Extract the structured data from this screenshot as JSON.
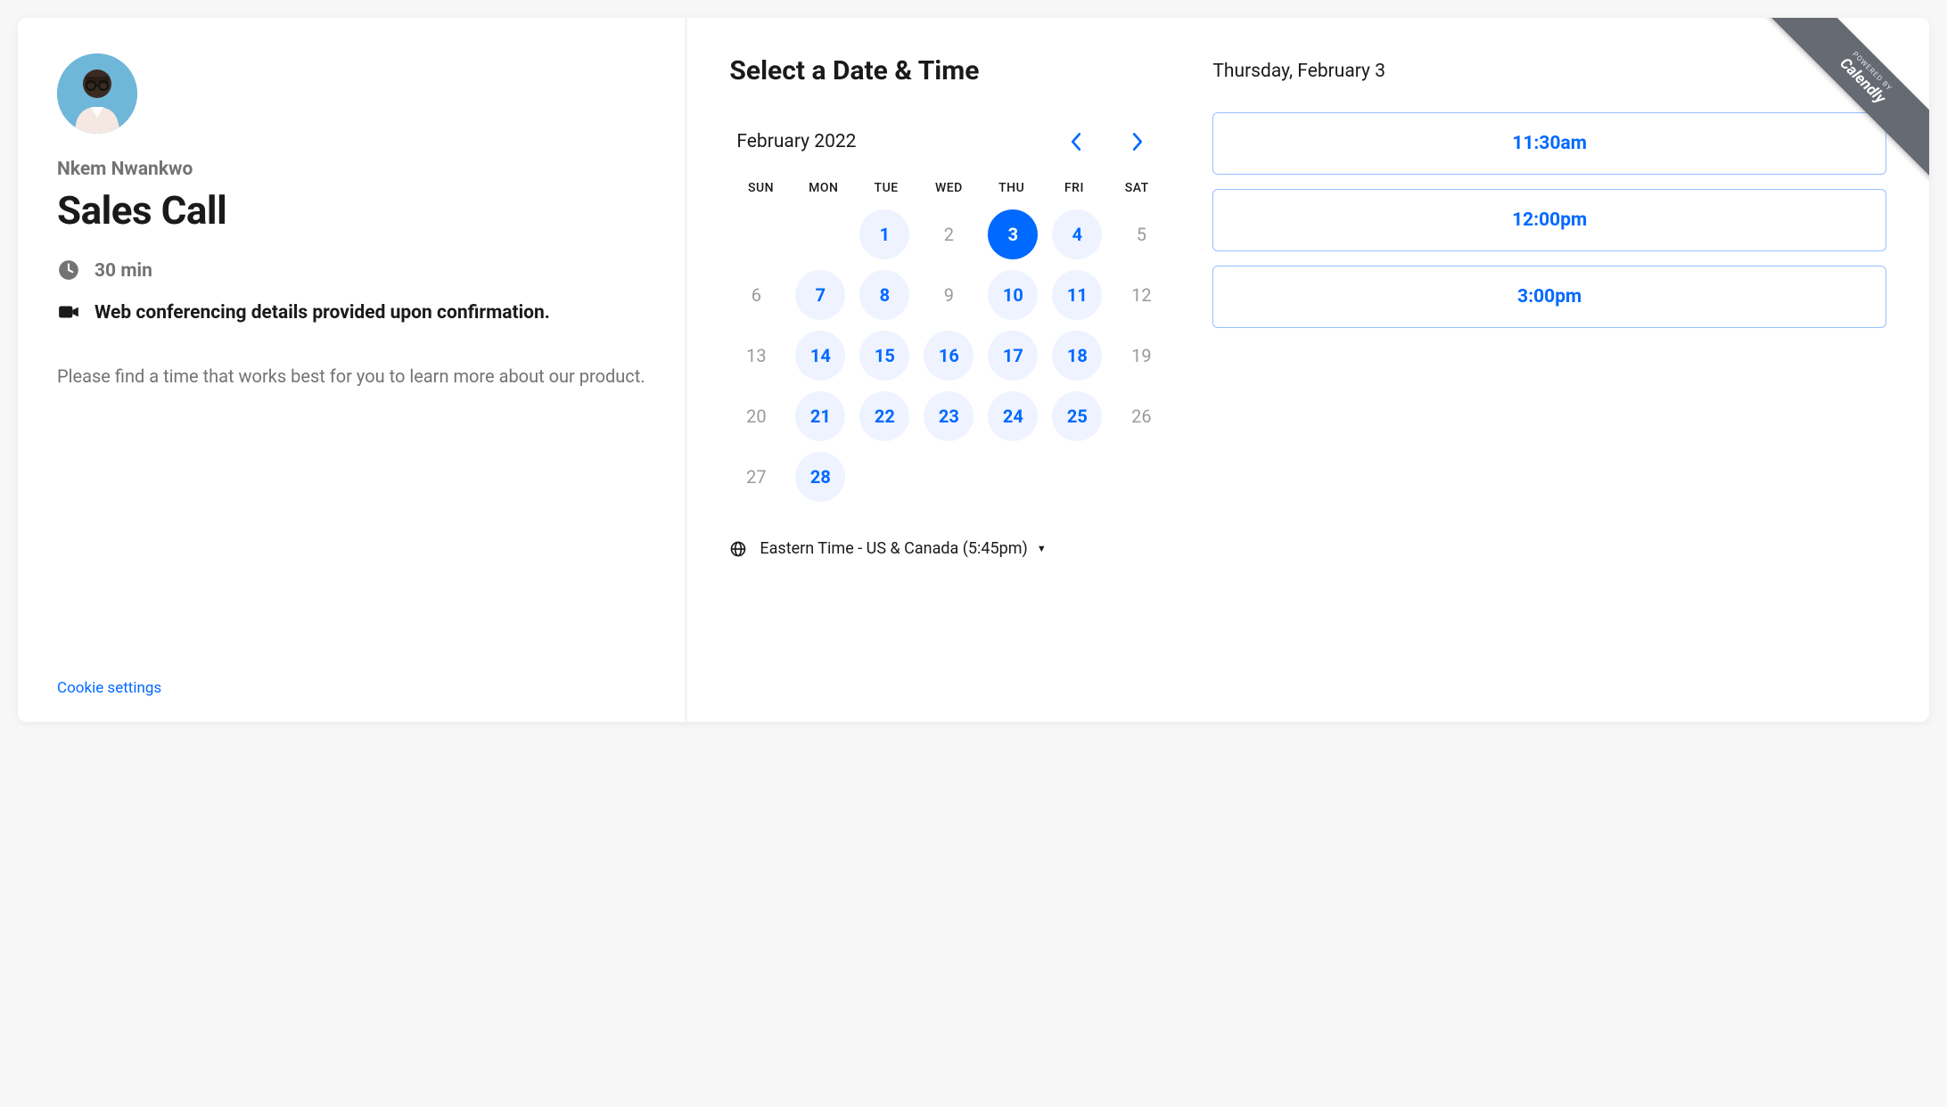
{
  "event": {
    "host_name": "Nkem Nwankwo",
    "title": "Sales Call",
    "duration": "30 min",
    "location": "Web conferencing details provided upon confirmation.",
    "description": "Please find a time that works best for you to learn more about our product."
  },
  "footer": {
    "cookie_settings": "Cookie settings"
  },
  "picker": {
    "title": "Select a Date & Time",
    "month_label": "February 2022",
    "dow": [
      "SUN",
      "MON",
      "TUE",
      "WED",
      "THU",
      "FRI",
      "SAT"
    ],
    "days": [
      {
        "n": "",
        "state": "empty"
      },
      {
        "n": "",
        "state": "empty"
      },
      {
        "n": "1",
        "state": "available"
      },
      {
        "n": "2",
        "state": "disabled"
      },
      {
        "n": "3",
        "state": "selected"
      },
      {
        "n": "4",
        "state": "available"
      },
      {
        "n": "5",
        "state": "disabled"
      },
      {
        "n": "6",
        "state": "disabled"
      },
      {
        "n": "7",
        "state": "available"
      },
      {
        "n": "8",
        "state": "available"
      },
      {
        "n": "9",
        "state": "disabled"
      },
      {
        "n": "10",
        "state": "available"
      },
      {
        "n": "11",
        "state": "available"
      },
      {
        "n": "12",
        "state": "disabled"
      },
      {
        "n": "13",
        "state": "disabled"
      },
      {
        "n": "14",
        "state": "available"
      },
      {
        "n": "15",
        "state": "available"
      },
      {
        "n": "16",
        "state": "available"
      },
      {
        "n": "17",
        "state": "available"
      },
      {
        "n": "18",
        "state": "available"
      },
      {
        "n": "19",
        "state": "disabled"
      },
      {
        "n": "20",
        "state": "disabled"
      },
      {
        "n": "21",
        "state": "available"
      },
      {
        "n": "22",
        "state": "available"
      },
      {
        "n": "23",
        "state": "available"
      },
      {
        "n": "24",
        "state": "available"
      },
      {
        "n": "25",
        "state": "available"
      },
      {
        "n": "26",
        "state": "disabled"
      },
      {
        "n": "27",
        "state": "disabled"
      },
      {
        "n": "28",
        "state": "available"
      }
    ],
    "timezone": "Eastern Time - US & Canada (5:45pm)"
  },
  "selection": {
    "date_label": "Thursday, February 3",
    "slots": [
      "11:30am",
      "12:00pm",
      "3:00pm"
    ]
  },
  "ribbon": {
    "pre": "POWERED BY",
    "brand": "Calendly"
  }
}
